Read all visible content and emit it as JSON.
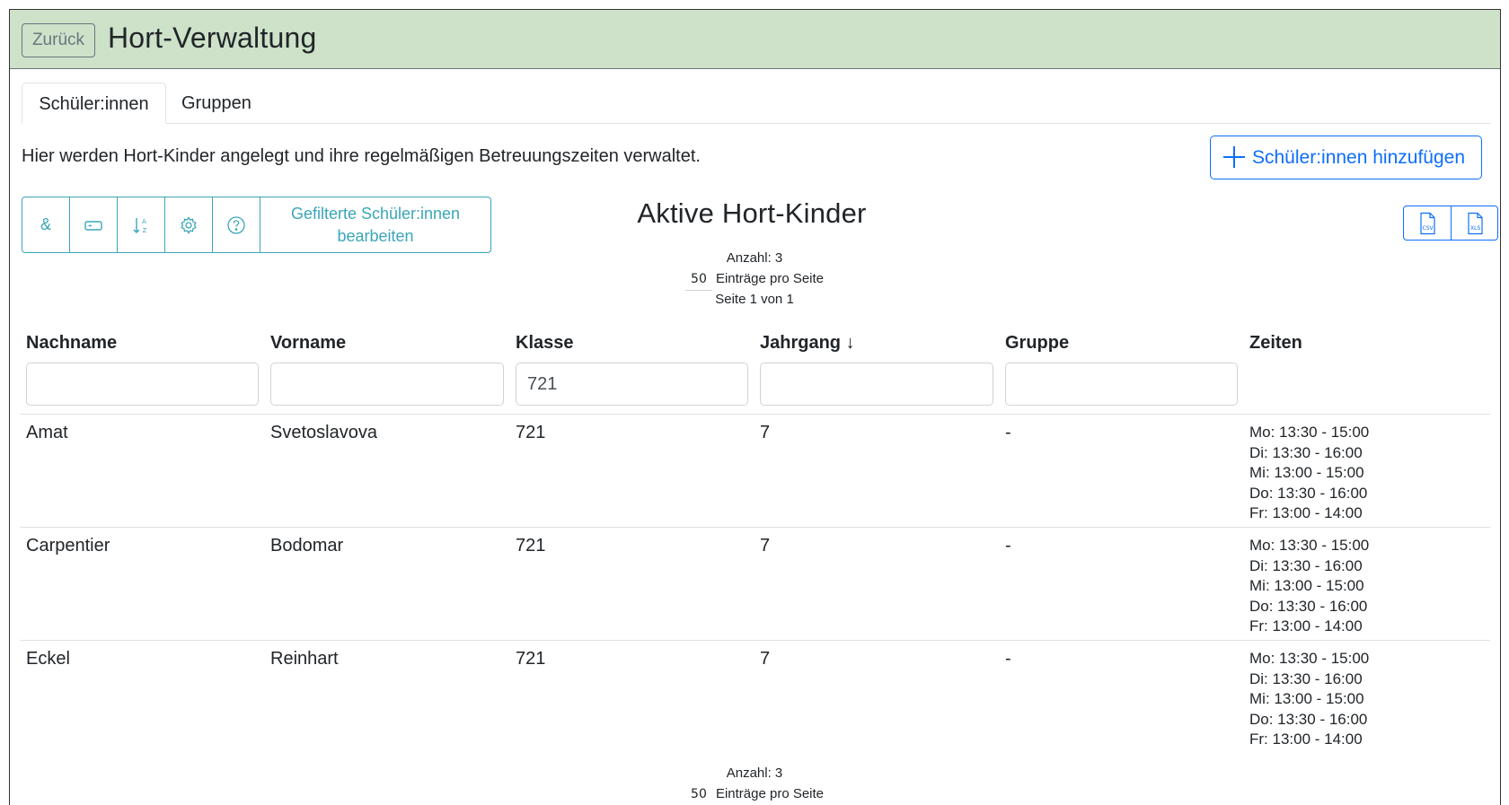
{
  "header": {
    "back_label": "Zurück",
    "title": "Hort-Verwaltung"
  },
  "tabs": [
    {
      "label": "Schüler:innen",
      "active": true
    },
    {
      "label": "Gruppen",
      "active": false
    }
  ],
  "description": "Hier werden Hort-Kinder angelegt und ihre regelmäßigen Betreuungszeiten verwaltet.",
  "add_button": {
    "label": "Schüler:innen hinzufügen",
    "icon": "plus-icon"
  },
  "toolbar": {
    "buttons": [
      {
        "icon": "ampersand-icon",
        "symbol": "&"
      },
      {
        "icon": "label-tag-icon"
      },
      {
        "icon": "sort-alpha-icon"
      },
      {
        "icon": "gear-icon"
      },
      {
        "icon": "question-circle-icon"
      }
    ],
    "edit_filtered_label": "Gefilterte Schüler:innen bearbeiten"
  },
  "list": {
    "title": "Aktive Hort-Kinder"
  },
  "export": {
    "buttons": [
      {
        "icon": "csv-file-icon",
        "label": "CSV"
      },
      {
        "icon": "xls-file-icon",
        "label": "XLS"
      }
    ]
  },
  "pager_top": {
    "count": "Anzahl: 3",
    "per_page": "50",
    "per_page_label": "Einträge pro Seite",
    "page": "Seite 1 von 1"
  },
  "pager_bottom": {
    "count": "Anzahl: 3",
    "per_page": "50",
    "per_page_label": "Einträge pro Seite"
  },
  "table": {
    "columns": [
      "Nachname",
      "Vorname",
      "Klasse",
      "Jahrgang ↓",
      "Gruppe",
      "Zeiten"
    ],
    "filters": [
      "",
      "",
      "721",
      "",
      ""
    ],
    "rows": [
      {
        "nachname": "Amat",
        "vorname": "Svetoslavova",
        "klasse": "721",
        "jahrgang": "7",
        "gruppe": "-",
        "zeiten": [
          "Mo: 13:30 - 15:00",
          "Di: 13:30 - 16:00",
          "Mi: 13:00 - 15:00",
          "Do: 13:30 - 16:00",
          "Fr: 13:00 - 14:00"
        ]
      },
      {
        "nachname": "Carpentier",
        "vorname": "Bodomar",
        "klasse": "721",
        "jahrgang": "7",
        "gruppe": "-",
        "zeiten": [
          "Mo: 13:30 - 15:00",
          "Di: 13:30 - 16:00",
          "Mi: 13:00 - 15:00",
          "Do: 13:30 - 16:00",
          "Fr: 13:00 - 14:00"
        ]
      },
      {
        "nachname": "Eckel",
        "vorname": "Reinhart",
        "klasse": "721",
        "jahrgang": "7",
        "gruppe": "-",
        "zeiten": [
          "Mo: 13:30 - 15:00",
          "Di: 13:30 - 16:00",
          "Mi: 13:00 - 15:00",
          "Do: 13:30 - 16:00",
          "Fr: 13:00 - 14:00"
        ]
      }
    ]
  },
  "colors": {
    "header_bg": "#cde2c9",
    "primary": "#0d6efd",
    "info": "#3aa6b9",
    "secondary": "#6c757d"
  }
}
